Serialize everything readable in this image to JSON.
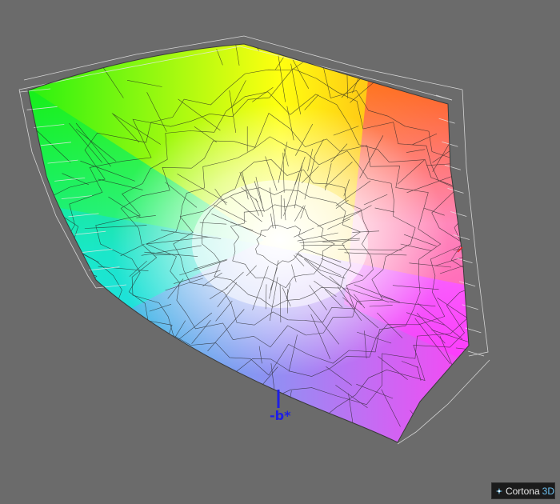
{
  "viewer": {
    "background_color": "#6b6b6b",
    "branding": {
      "name": "Cortona",
      "suffix": "3D",
      "icon": "cortona-logo-icon"
    }
  },
  "scene": {
    "axis_label": "-b*",
    "axis_color": "#1e1ee6",
    "marker_color": "#e02020",
    "gamut_fill_corners": {
      "green": "#10f010",
      "yellow": "#ffff10",
      "red": "#ff4020",
      "magenta": "#ff30ff",
      "blue": "#6a6aff",
      "cyan": "#10f0f0",
      "white": "#ffffff"
    },
    "wireframe_colors": {
      "dark": "#222222",
      "light": "#e6e6e6"
    }
  }
}
